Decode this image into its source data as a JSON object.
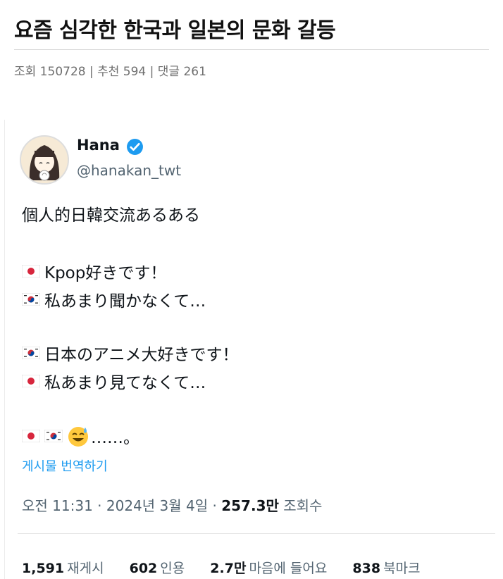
{
  "post": {
    "title": "요즘 심각한 한국과 일본의 문화 갈등",
    "stats": "조회 150728 | 추천 594 | 댓글 261"
  },
  "tweet": {
    "name": "Hana",
    "handle": "@hanakan_twt",
    "lines": {
      "l1": "個人的日韓交流あるある",
      "l2": "Kpop好きです！",
      "l3": "私あまり聞かなくて…",
      "l4": "日本のアニメ大好きです！",
      "l5": "私あまり見てなくて…",
      "l6": "……。"
    },
    "translate": "게시물 번역하기",
    "meta": {
      "time": "오전 11:31",
      "date": "2024년 3월 4일",
      "views_num": "257.3만",
      "views_label": "조회수"
    },
    "counts": {
      "retweets_num": "1,591",
      "retweets_label": "재게시",
      "quotes_num": "602",
      "quotes_label": "인용",
      "likes_num": "2.7만",
      "likes_label": "마음에 들어요",
      "bookmarks_num": "838",
      "bookmarks_label": "북마크"
    }
  },
  "colors": {
    "link": "#1d9bf0",
    "verified": "#1d9bf0",
    "muted": "#536471"
  },
  "icons": [
    "avatar",
    "verified-badge-icon",
    "japan-flag-icon",
    "korea-flag-icon",
    "sweat-smile-emoji-icon"
  ]
}
